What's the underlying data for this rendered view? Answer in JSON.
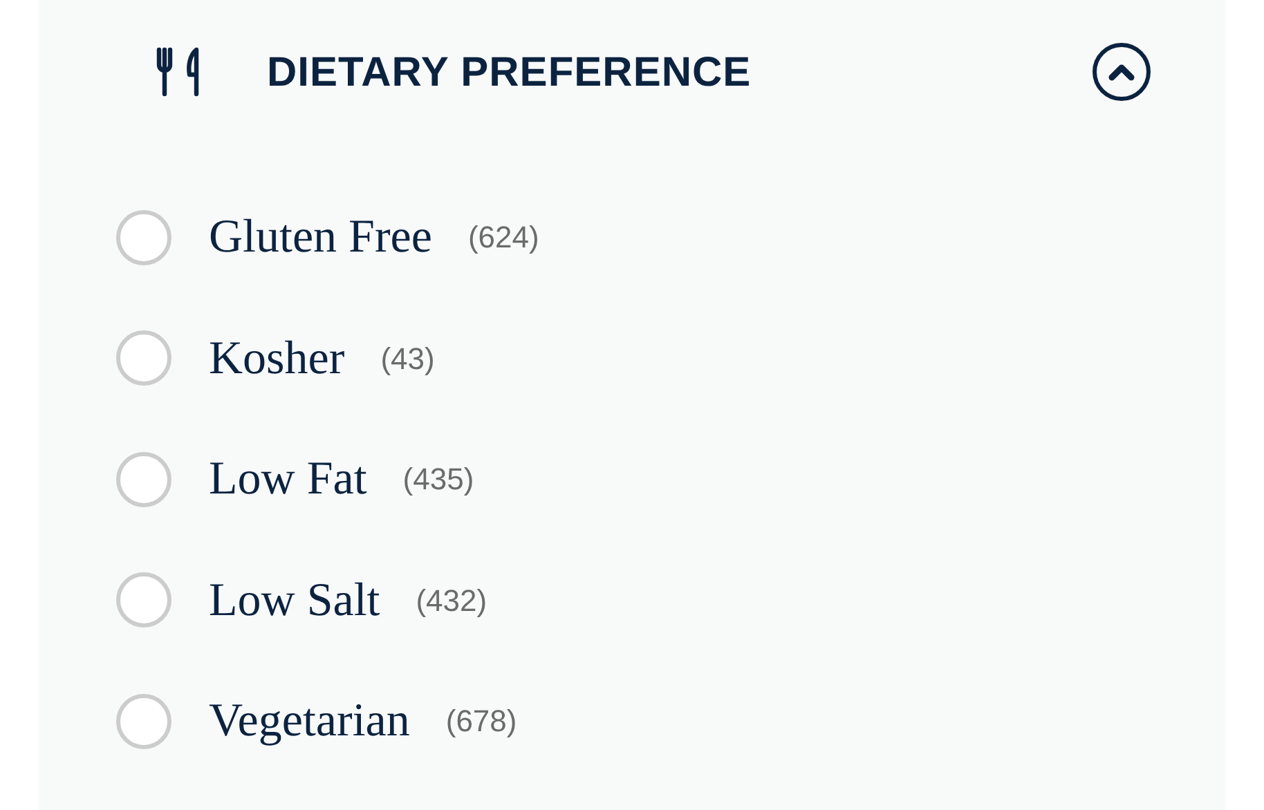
{
  "filter": {
    "title": "DIETARY PREFERENCE",
    "expanded": true,
    "options": [
      {
        "label": "Gluten Free",
        "count": "(624)",
        "selected": false
      },
      {
        "label": "Kosher",
        "count": "(43)",
        "selected": false
      },
      {
        "label": "Low Fat",
        "count": "(435)",
        "selected": false
      },
      {
        "label": "Low Salt",
        "count": "(432)",
        "selected": false
      },
      {
        "label": "Vegetarian",
        "count": "(678)",
        "selected": false
      }
    ]
  }
}
